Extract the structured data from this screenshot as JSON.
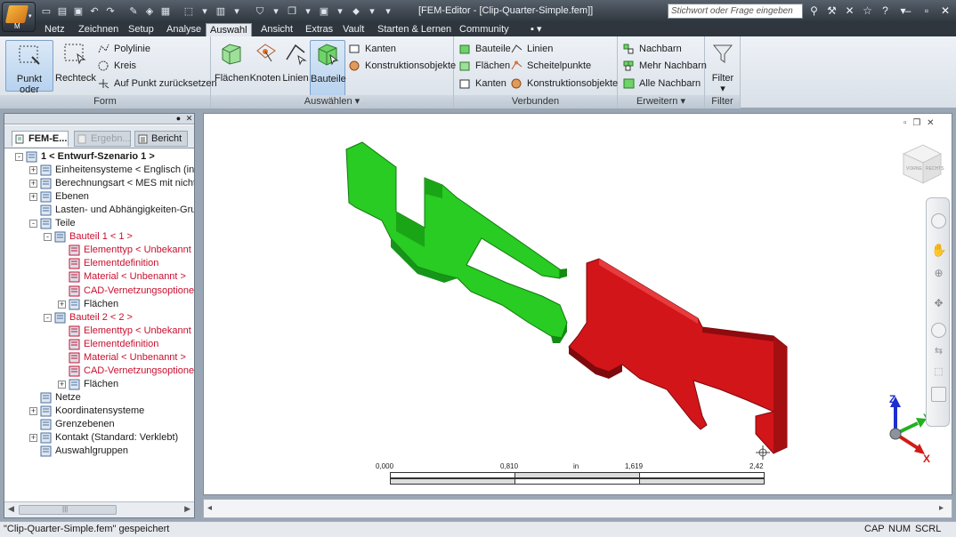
{
  "window": {
    "title": "[FEM-Editor - [Clip-Quarter-Simple.fem]]",
    "app_button_label": "M",
    "search_placeholder": "Stichwort oder Frage eingeben"
  },
  "menu_tabs": [
    "Netz",
    "Zeichnen",
    "Setup",
    "Analyse",
    "Auswahl",
    "Ansicht",
    "Extras",
    "Vault",
    "Starten & Lernen",
    "Community"
  ],
  "active_tab": "Auswahl",
  "ribbon": {
    "form": {
      "title": "Form",
      "big_buttons": [
        "Punkt oder Rechteck",
        "Rechteck"
      ],
      "small_buttons": [
        "Polylinie",
        "Kreis",
        "Auf Punkt zurücksetzen"
      ]
    },
    "auswaehlen": {
      "title": "Auswählen",
      "big_buttons": [
        "Flächen",
        "Knoten",
        "Linien",
        "Bauteile"
      ],
      "small_buttons": [
        "Kanten",
        "Konstruktionsobjekte"
      ]
    },
    "verbunden": {
      "title": "Verbunden",
      "small_buttons": [
        "Bauteile",
        "Linien",
        "Flächen",
        "Scheitelpunkte",
        "Kanten",
        "Konstruktionsobjekte"
      ]
    },
    "erweitern": {
      "title": "Erweitern",
      "small_buttons": [
        "Nachbarn",
        "Mehr Nachbarn",
        "Alle Nachbarn"
      ]
    },
    "filter": {
      "title": "Filter",
      "big_button": "Filter"
    }
  },
  "browser": {
    "tabs": [
      "FEM-E...",
      "Ergebn...",
      "Bericht"
    ],
    "tree": [
      {
        "label": "1 < Entwurf-Szenario 1 >",
        "level": 0,
        "bold": true,
        "toggle": "-",
        "red": false
      },
      {
        "label": "Einheitensysteme < Englisch (in) >",
        "level": 1,
        "toggle": "+",
        "red": false
      },
      {
        "label": "Berechnungsart < MES mit nichtlin",
        "level": 1,
        "toggle": "+",
        "red": false
      },
      {
        "label": "Ebenen",
        "level": 1,
        "toggle": "+",
        "red": false
      },
      {
        "label": "Lasten- und Abhängigkeiten-Grup",
        "level": 1,
        "toggle": "",
        "red": false
      },
      {
        "label": "Teile",
        "level": 1,
        "toggle": "-",
        "red": false
      },
      {
        "label": "Bauteil 1 < 1 >",
        "level": 2,
        "toggle": "-",
        "red": true
      },
      {
        "label": "Elementtyp < Unbekannt >",
        "level": 3,
        "toggle": "",
        "red": true
      },
      {
        "label": "Elementdefinition",
        "level": 3,
        "toggle": "",
        "red": true
      },
      {
        "label": "Material < Unbenannt >",
        "level": 3,
        "toggle": "",
        "red": true
      },
      {
        "label": "CAD-Vernetzungsoptionen",
        "level": 3,
        "toggle": "",
        "red": true
      },
      {
        "label": "Flächen",
        "level": 3,
        "toggle": "+",
        "red": false
      },
      {
        "label": "Bauteil 2 < 2 >",
        "level": 2,
        "toggle": "-",
        "red": true
      },
      {
        "label": "Elementtyp < Unbekannt >",
        "level": 3,
        "toggle": "",
        "red": true
      },
      {
        "label": "Elementdefinition",
        "level": 3,
        "toggle": "",
        "red": true
      },
      {
        "label": "Material < Unbenannt >",
        "level": 3,
        "toggle": "",
        "red": true
      },
      {
        "label": "CAD-Vernetzungsoptionen",
        "level": 3,
        "toggle": "",
        "red": true
      },
      {
        "label": "Flächen",
        "level": 3,
        "toggle": "+",
        "red": false
      },
      {
        "label": "Netze",
        "level": 1,
        "toggle": "",
        "red": false
      },
      {
        "label": "Koordinatensysteme",
        "level": 1,
        "toggle": "+",
        "red": false
      },
      {
        "label": "Grenzebenen",
        "level": 1,
        "toggle": "",
        "red": false
      },
      {
        "label": "Kontakt (Standard: Verklebt)",
        "level": 1,
        "toggle": "+",
        "red": false
      },
      {
        "label": "Auswahlgruppen",
        "level": 1,
        "toggle": "",
        "red": false
      }
    ]
  },
  "viewport": {
    "scale": {
      "ticks": [
        "0,000",
        "0,810",
        "in",
        "1,619",
        "2,42"
      ]
    },
    "viewcube_labels": [
      "VORNE",
      "RECHTS"
    ],
    "axes": {
      "x": "X",
      "y": "Y",
      "z": "Z"
    },
    "part_colors": {
      "part1": "#22d21e",
      "part2": "#d0121a"
    }
  },
  "status": {
    "message": "\"Clip-Quarter-Simple.fem\" gespeichert",
    "indicators": [
      "CAP",
      "NUM",
      "SCRL"
    ]
  }
}
